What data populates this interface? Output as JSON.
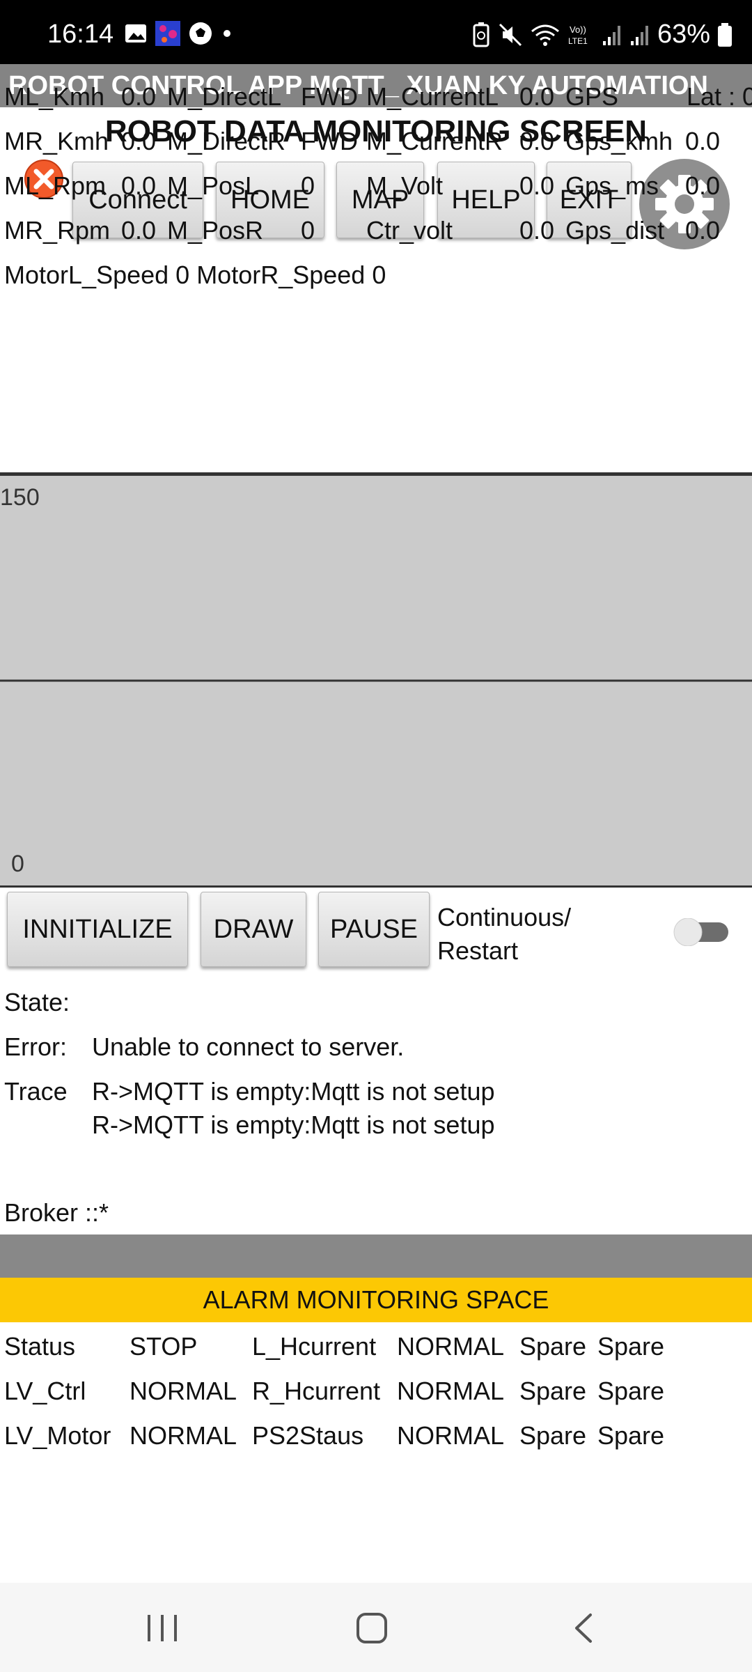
{
  "status_bar": {
    "time": "16:14",
    "battery": "63%",
    "notification_icons": [
      "image-icon",
      "app-icon",
      "soccer-icon",
      "dot-icon"
    ],
    "system_icons": [
      "battery-saver-icon",
      "mute-icon",
      "wifi-icon",
      "volte-icon",
      "signal-icon",
      "signal-icon"
    ]
  },
  "app": {
    "title": "ROBOT CONTROL APP MQTT_ XUAN KY AUTOMATION",
    "screen_title": "ROBOT DATA MONITORING SCREEN"
  },
  "toolbar": {
    "connect": "Connect",
    "home": "HOME",
    "map": "MAP",
    "help": "HELP",
    "exit": "EXIT"
  },
  "metrics": {
    "rows": [
      [
        "ML_Kmh",
        "0.0",
        "M_DirectL",
        "FWD",
        "M_CurrentL",
        "0.0",
        "GPS",
        "",
        "Lat : 0"
      ],
      [
        "MR_Kmh",
        "0.0",
        "M_DirectR",
        "FWD",
        "M_CurrentR",
        "0.0",
        "Gps_kmh",
        "0.0",
        ""
      ],
      [
        "ML_Rpm",
        "0.0",
        "M_PosL",
        "0",
        "M_Volt",
        "0.0",
        "Gps_ms",
        "0.0",
        ""
      ],
      [
        "MR_Rpm",
        "0.0",
        "M_PosR",
        "0",
        "Ctr_volt",
        "0.0",
        "Gps_dist",
        "0.0",
        ""
      ]
    ],
    "speed_line": "MotorL_Speed 0 MotorR_Speed 0"
  },
  "chart_data": {
    "type": "line",
    "y_max_label": "150",
    "y_min_label": "0",
    "ylim": [
      0,
      150
    ],
    "midline": 75,
    "series": []
  },
  "controls": {
    "initialize": "INNITIALIZE",
    "draw": "DRAW",
    "pause": "PAUSE",
    "continuous_line1": "Continuous/",
    "continuous_line2": "Restart",
    "toggle_on": false
  },
  "info": {
    "state_label": "State:",
    "state_value": "",
    "error_label": "Error:",
    "error_value": "Unable to connect to server.",
    "trace_label": "Trace",
    "trace_line1": "R->MQTT is empty:Mqtt is not setup",
    "trace_line2": "R->MQTT is empty:Mqtt is not setup",
    "broker": "Broker ::*"
  },
  "alarm": {
    "header": "ALARM MONITORING SPACE",
    "rows": [
      [
        "Status",
        "STOP",
        "L_Hcurrent",
        "NORMAL",
        "Spare",
        "Spare"
      ],
      [
        "LV_Ctrl",
        "NORMAL",
        "R_Hcurrent",
        "NORMAL",
        "Spare",
        "Spare"
      ],
      [
        "LV_Motor",
        "NORMAL",
        "PS2Staus",
        "NORMAL",
        "Spare",
        "Spare"
      ]
    ]
  },
  "colors": {
    "title_bar": "#848484",
    "alarm_header": "#fcc804",
    "chart_bg": "#cbcbcb"
  }
}
